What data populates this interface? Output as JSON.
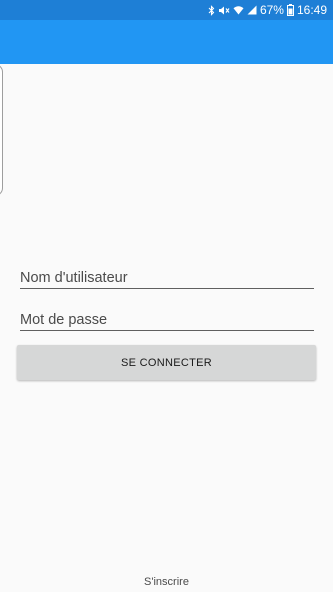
{
  "status_bar": {
    "battery_percent": "67%",
    "time": "16:49",
    "icons": [
      "bluetooth-icon",
      "mute-icon",
      "wifi-icon",
      "signal-icon",
      "battery-icon"
    ]
  },
  "colors": {
    "status_bar": "#1e7fd6",
    "app_bar": "#2196f3",
    "background": "#fafafa",
    "button_bg": "#d6d7d7"
  },
  "form": {
    "username_placeholder": "Nom d'utilisateur",
    "username_value": "",
    "password_placeholder": "Mot de passe",
    "password_value": "",
    "login_label": "SE CONNECTER"
  },
  "footer": {
    "register_label": "S'inscrire"
  }
}
